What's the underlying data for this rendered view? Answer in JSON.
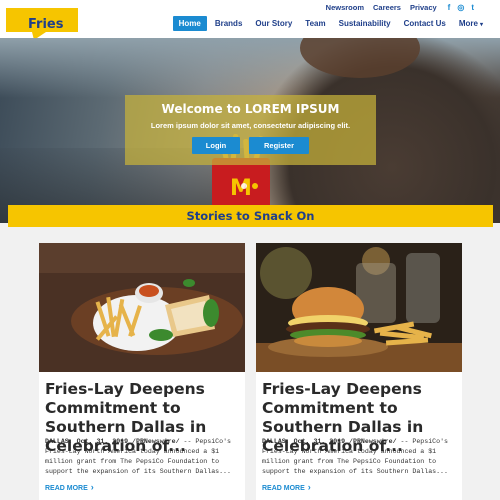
{
  "brand": {
    "logo_text": "Fries",
    "logo_color": "#f6c500",
    "text_color": "#1f3f8a"
  },
  "top_links": [
    "Newsroom",
    "Careers",
    "Privacy"
  ],
  "social_icons": [
    {
      "name": "facebook-icon",
      "glyph": "f"
    },
    {
      "name": "instagram-icon",
      "glyph": "◎"
    },
    {
      "name": "twitter-icon",
      "glyph": "t"
    }
  ],
  "nav": {
    "items": [
      "Home",
      "Brands",
      "Our Story",
      "Team",
      "Sustainability",
      "Contact Us",
      "More"
    ],
    "active": "Home",
    "more_caret": "▾"
  },
  "hero": {
    "title": "Welcome to LOREM IPSUM",
    "subtitle": "Lorem ipsum dolor sit amet, consectetur adipiscing elit.",
    "login_label": "Login",
    "register_label": "Register",
    "slides": 2,
    "active_slide": 2
  },
  "stories_heading": "Stories to Snack On",
  "cards": [
    {
      "title": "Fries-Lay Deepens Commitment to Southern Dallas in Celebration of...",
      "dateline": "DALLAS, Oct. 31, 2019 /PRNewswire/",
      "body": "-- PepsiCo's Fries-Lay North America today announced a $1 million grant from The PepsiCo Foundation to support the expansion of its Southern Dallas...",
      "read_more": "READ MORE"
    },
    {
      "title": "Fries-Lay Deepens Commitment to Southern Dallas in Celebration of...",
      "dateline": "DALLAS, Oct. 31, 2019 /PRNewswire/",
      "body": "-- PepsiCo's Fries-Lay North America today announced a $1 million grant from The PepsiCo Foundation to support the expansion of its Southern Dallas...",
      "read_more": "READ MORE"
    }
  ],
  "colors": {
    "accent_blue": "#1b8bd1",
    "accent_yellow": "#f6c500",
    "heading_navy": "#1f3f8a"
  }
}
